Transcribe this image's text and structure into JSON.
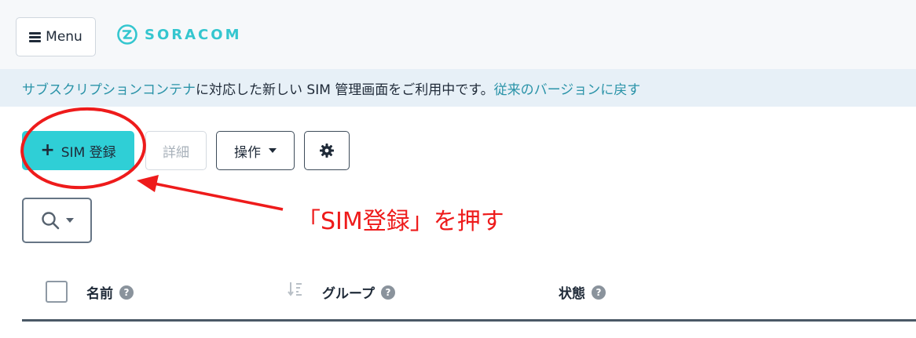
{
  "header": {
    "menu_label": "Menu",
    "brand_name": "SORACOM",
    "brand_color": "#34c6cf"
  },
  "notice": {
    "link_text": "サブスクリプションコンテナ",
    "message": "に対応した新しい SIM 管理画面をご利用中です。",
    "revert_link": "従来のバージョンに戻す"
  },
  "toolbar": {
    "register_icon": "plus-icon",
    "register_label": "SIM 登録",
    "detail_label": "詳細",
    "operations_label": "操作",
    "settings_icon": "gear-icon",
    "accent_color": "#2fcfd6"
  },
  "search": {
    "icon": "search-icon"
  },
  "table": {
    "columns": [
      {
        "label": "名前",
        "help_icon": "question-icon"
      },
      {
        "label": "グループ",
        "help_icon": "question-icon",
        "sort_icon": "sort-icon"
      },
      {
        "label": "状態",
        "help_icon": "question-icon"
      }
    ],
    "help_glyph": "?"
  },
  "annotation": {
    "text": "「SIM登録」を押す",
    "color": "#ee1b1b"
  }
}
